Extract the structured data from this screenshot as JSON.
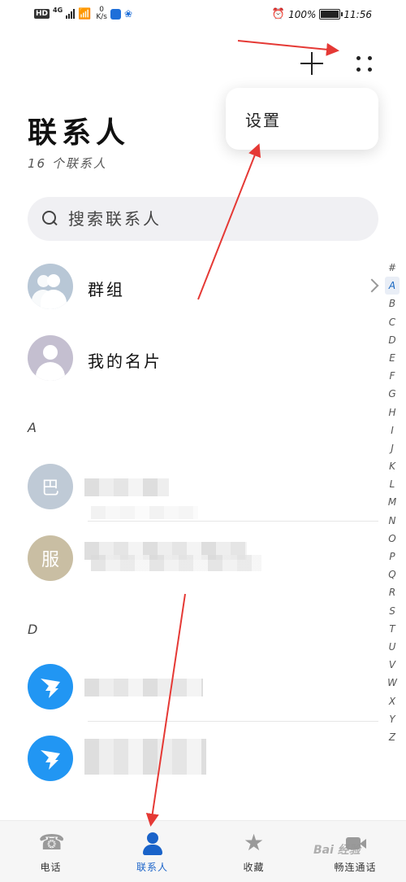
{
  "status_bar": {
    "hd": "HD",
    "network": "4G",
    "speed_value": "0",
    "speed_unit": "K/s",
    "battery_percent": "100%",
    "time": "11:56"
  },
  "menu": {
    "settings_label": "设置"
  },
  "header": {
    "title": "联系人",
    "count": "16 个联系人"
  },
  "search": {
    "placeholder": "搜索联系人"
  },
  "list": {
    "group_label": "群组",
    "my_card_label": "我的名片",
    "sections": [
      {
        "letter": "A",
        "contacts": [
          {
            "avatar_text": "巴"
          },
          {
            "avatar_text": "服"
          }
        ]
      },
      {
        "letter": "D",
        "contacts": [
          {
            "avatar_icon": "dingtalk-icon"
          },
          {
            "avatar_icon": "dingtalk-icon"
          }
        ]
      }
    ]
  },
  "alphabet": [
    "#",
    "A",
    "B",
    "C",
    "D",
    "E",
    "F",
    "G",
    "H",
    "I",
    "J",
    "K",
    "L",
    "M",
    "N",
    "O",
    "P",
    "Q",
    "R",
    "S",
    "T",
    "U",
    "V",
    "W",
    "X",
    "Y",
    "Z"
  ],
  "alphabet_active": "A",
  "bottom_nav": {
    "tabs": [
      {
        "label": "电话",
        "icon": "phone-icon"
      },
      {
        "label": "联系人",
        "icon": "contacts-icon",
        "active": true
      },
      {
        "label": "收藏",
        "icon": "star-icon"
      },
      {
        "label": "畅连通话",
        "icon": "video-call-icon"
      }
    ]
  },
  "watermark": "Bai 经验",
  "colors": {
    "accent": "#1a63c9",
    "annotation_arrow": "#e53935",
    "dingtalk_blue": "#2196f3"
  }
}
